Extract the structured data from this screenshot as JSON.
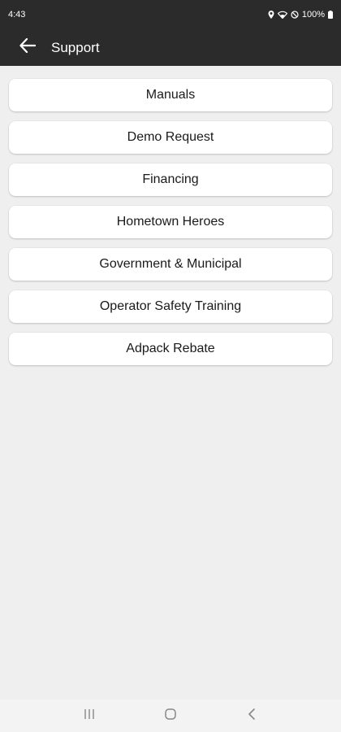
{
  "status_bar": {
    "time": "4:43",
    "icons": [
      "location-icon",
      "wifi-icon",
      "do-not-disturb-icon",
      "battery-icon"
    ],
    "battery": "100%"
  },
  "app_bar": {
    "back_icon": "arrow-left-icon",
    "title": "Support"
  },
  "menu": {
    "items": [
      {
        "label": "Manuals"
      },
      {
        "label": "Demo Request"
      },
      {
        "label": "Financing"
      },
      {
        "label": "Hometown Heroes"
      },
      {
        "label": "Government & Municipal"
      },
      {
        "label": "Operator Safety Training"
      },
      {
        "label": "Adpack Rebate"
      }
    ]
  },
  "nav_bar": {
    "buttons": [
      "recent-apps-icon",
      "home-icon",
      "back-icon"
    ]
  },
  "colors": {
    "app_bar": "#2b2b2b",
    "background": "#efefef",
    "card": "#ffffff"
  }
}
